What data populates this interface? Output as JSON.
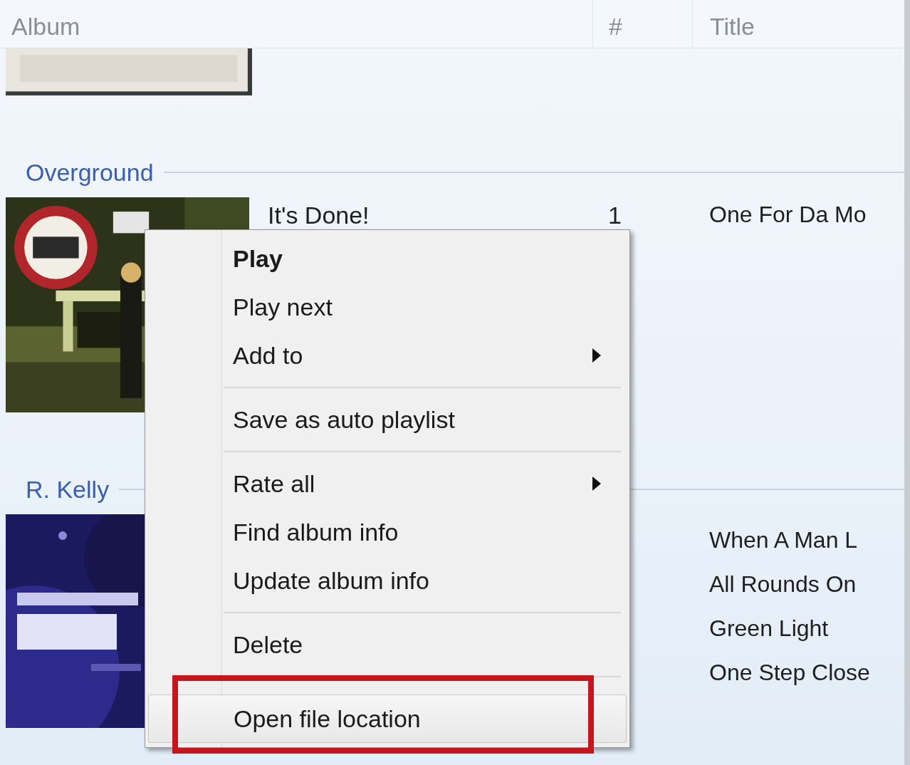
{
  "columns": [
    {
      "label": "Album"
    },
    {
      "label": "#"
    },
    {
      "label": "Title"
    }
  ],
  "groups": [
    {
      "art": {
        "kind": "picture"
      }
    },
    {
      "artist": "Overground",
      "art": {
        "kind": "picture"
      },
      "album": "It's Done!",
      "tracks": [
        {
          "number": "1",
          "title": "One For Da Mo"
        }
      ]
    },
    {
      "artist": "R. Kelly",
      "art": {
        "kind": "picture"
      },
      "tracks": [
        {
          "title": "When A Man L"
        },
        {
          "title": "All Rounds On"
        },
        {
          "title": "Green Light"
        },
        {
          "title": "One Step Close"
        }
      ]
    }
  ],
  "context_menu": {
    "items": [
      {
        "kind": "item",
        "label": "Play",
        "bold": true,
        "submenu": false,
        "selected": false
      },
      {
        "kind": "item",
        "label": "Play next",
        "bold": false,
        "submenu": false,
        "selected": false
      },
      {
        "kind": "item",
        "label": "Add to",
        "bold": false,
        "submenu": true,
        "selected": false
      },
      {
        "kind": "separator"
      },
      {
        "kind": "item",
        "label": "Save as auto playlist",
        "bold": false,
        "submenu": false,
        "selected": false
      },
      {
        "kind": "separator"
      },
      {
        "kind": "item",
        "label": "Rate all",
        "bold": false,
        "submenu": true,
        "selected": false
      },
      {
        "kind": "item",
        "label": "Find album info",
        "bold": false,
        "submenu": false,
        "selected": false
      },
      {
        "kind": "item",
        "label": "Update album info",
        "bold": false,
        "submenu": false,
        "selected": false
      },
      {
        "kind": "separator"
      },
      {
        "kind": "item",
        "label": "Delete",
        "bold": false,
        "submenu": false,
        "selected": false
      },
      {
        "kind": "separator"
      },
      {
        "kind": "item",
        "label": "Open file location",
        "bold": false,
        "submenu": false,
        "selected": true
      }
    ]
  }
}
